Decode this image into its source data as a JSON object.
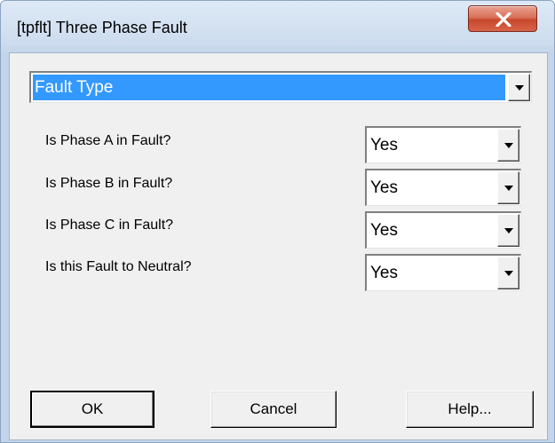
{
  "window": {
    "title": "[tpflt] Three Phase Fault"
  },
  "fault_type": {
    "value": "Fault Type"
  },
  "rows": [
    {
      "label": "Is Phase A in Fault?",
      "value": "Yes"
    },
    {
      "label": "Is Phase B in Fault?",
      "value": "Yes"
    },
    {
      "label": "Is Phase C in Fault?",
      "value": "Yes"
    },
    {
      "label": "Is this Fault to Neutral?",
      "value": "Yes"
    }
  ],
  "buttons": {
    "ok": "OK",
    "cancel": "Cancel",
    "help": "Help..."
  },
  "icons": {
    "close": "close-icon",
    "dropdown": "chevron-down-icon"
  },
  "colors": {
    "selection": "#3399ff",
    "close_button": "#c7482b",
    "dialog_face": "#f0f0f0"
  }
}
